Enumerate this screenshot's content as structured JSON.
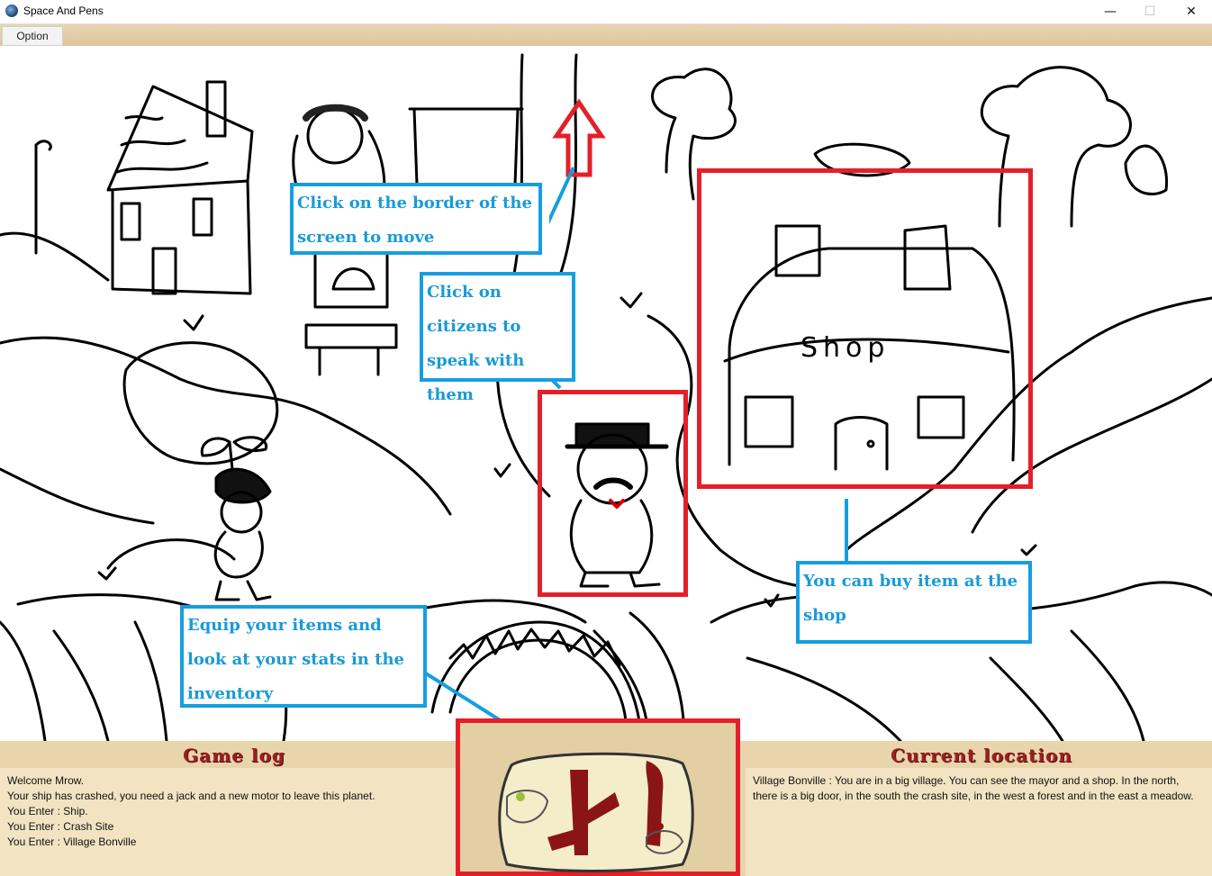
{
  "window": {
    "title": "Space And Pens",
    "controls": {
      "minimize": "—",
      "maximize": "☐",
      "close": "✕"
    }
  },
  "menu": {
    "option_label": "Option"
  },
  "callouts": {
    "move": "Click on the border of the screen to move",
    "citizens": "Click on citizens to speak with them",
    "shop": "You can buy item at the shop",
    "inventory": "Equip your items and look at your stats in the inventory"
  },
  "scene": {
    "shop_sign": "Shop"
  },
  "game_log": {
    "title": "Game log",
    "lines": [
      "Welcome Mrow.",
      "Your ship has crashed, you need a jack and a new motor to leave this planet.",
      "You Enter : Ship.",
      "You Enter : Crash Site",
      "You Enter : Village Bonville"
    ]
  },
  "current_location": {
    "title": "Current location",
    "text": "Village Bonville : You are in a big village. You can see the mayor and a shop. In the north, there is a big door, in the south the crash site, in the west a forest and in the east a meadow."
  },
  "colors": {
    "callout_blue": "#169ee0",
    "highlight_red": "#e3202a",
    "panel_title": "#9b2020",
    "parchment": "#e9d5ac"
  }
}
